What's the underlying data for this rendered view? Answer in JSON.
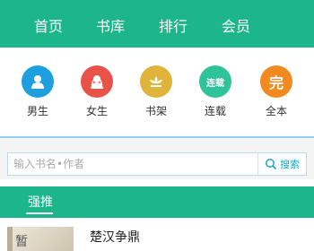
{
  "nav": {
    "items": [
      "首页",
      "书库",
      "排行",
      "会员"
    ],
    "bg_color": "#1db58a"
  },
  "categories": [
    {
      "label": "男生",
      "icon": "male-user-icon",
      "color": "#1e9fe0"
    },
    {
      "label": "女生",
      "icon": "female-user-icon",
      "color": "#e95248"
    },
    {
      "label": "书架",
      "icon": "bookshelf-lotus-icon",
      "color": "#e0b43a"
    },
    {
      "label": "连载",
      "icon": "serializing-icon",
      "color": "#2fc39a",
      "badge": "连载"
    },
    {
      "label": "全本",
      "icon": "complete-icon",
      "color": "#f28a1f",
      "badge": "完"
    }
  ],
  "search": {
    "placeholder": "输入书名•作者",
    "button_label": "搜索"
  },
  "section": {
    "title": "强推"
  },
  "book": {
    "cover_text": "暂",
    "title": "楚汉争鼎"
  }
}
